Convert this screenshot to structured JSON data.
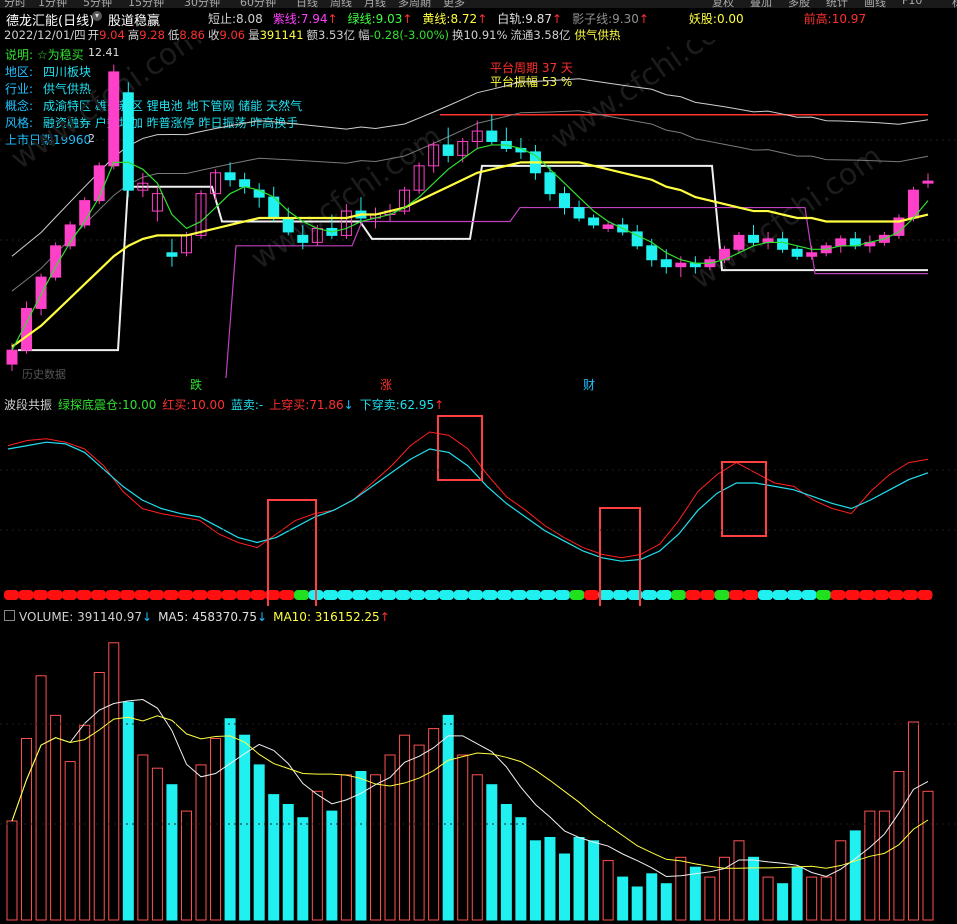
{
  "menu": {
    "periods": [
      "分时",
      "1分钟",
      "5分钟",
      "15分钟",
      "30分钟",
      "60分钟",
      "日线",
      "周线",
      "月线",
      "多周期",
      "更多"
    ],
    "right_buttons": [
      "复权",
      "叠加",
      "多股",
      "统计",
      "画线",
      "F10",
      "标记"
    ]
  },
  "header": {
    "stock_name": "德龙汇能(日线)",
    "indicator_name": "股道稳赢",
    "row1": [
      {
        "label": "短止:",
        "value": "8.08",
        "color": "#d0d0d0"
      },
      {
        "label": "紫线:",
        "value": "7.94",
        "arrow": "↑",
        "color": "#ff40ff"
      },
      {
        "label": "绿线:",
        "value": "9.03",
        "arrow": "↑",
        "color": "#40ff40"
      },
      {
        "label": "黄线:",
        "value": "8.72",
        "arrow": "↑",
        "color": "#ffff40"
      },
      {
        "label": "白轨:",
        "value": "9.87",
        "arrow": "↑",
        "color": "#e0e0e0"
      },
      {
        "label": "影子线:",
        "value": "9.30",
        "arrow": "↑",
        "color": "#909090"
      },
      {
        "label": "妖股:",
        "value": "0.00",
        "color": "#ffff40"
      },
      {
        "label": "前高:",
        "value": "10.97",
        "color": "#ff3030"
      }
    ],
    "row2": {
      "date": "2022/12/01/四",
      "open_label": "开",
      "open": "9.04",
      "high_label": "高",
      "high": "9.28",
      "low_label": "低",
      "low": "8.86",
      "close_label": "收",
      "close": "9.06",
      "vol_label": "量",
      "vol": "391141",
      "amount_label": "额",
      "amount": "3.53亿",
      "chg_label": "幅",
      "chg": "-0.28(-3.00%)",
      "turn_label": "换",
      "turn": "10.91%",
      "float_label": "流通",
      "float": "3.58亿",
      "tag": "供气供热"
    }
  },
  "info_panel": {
    "note": "说明: ☆为稳买",
    "region_label": "地区:",
    "region": "四川板块",
    "industry_label": "行业:",
    "industry": "供气供热",
    "concept_label": "概念:",
    "concept": "成渝特区 雄安新区 锂电池 地下管网 储能 天然气",
    "style_label": "风格:",
    "style": "融资融券 户数增加 昨普涨停 昨日振荡 昨高换手",
    "listing_label": "上市日期",
    "listing": "19960"
  },
  "platform": {
    "period_label": "平台周期",
    "period": "37 天",
    "amp_label": "平台振幅",
    "amp": "53 %"
  },
  "price_labels": {
    "max": "12.41",
    "min": "2"
  },
  "bottom_markers": [
    "跌",
    "涨",
    "财"
  ],
  "watermark": "www.cfchi.com",
  "wm_left": "历史数据",
  "colors": {
    "up": "#ff40c8",
    "down": "#20f0f0",
    "red": "#ff3030",
    "yellow": "#ffff40",
    "green": "#30e030",
    "white": "#f0f0f0",
    "purple": "#c040c0"
  },
  "osc": {
    "title": "波段共振",
    "items": [
      {
        "label": "绿探底震仓:",
        "value": "10.00",
        "color": "#30e030"
      },
      {
        "label": "红买:",
        "value": "10.00",
        "color": "#ff3030"
      },
      {
        "label": "蓝卖:",
        "value": "-",
        "color": "#20e0f0"
      },
      {
        "label": "上穿买:",
        "value": "71.86",
        "arrow": "↓",
        "color": "#ff3030"
      },
      {
        "label": "下穿卖:",
        "value": "62.95",
        "arrow": "↑",
        "color": "#20e0f0"
      }
    ]
  },
  "volume_panel": {
    "items": [
      {
        "label": "VOLUME:",
        "value": "391140.97",
        "arrow": "↓",
        "color": "#d0d0d0"
      },
      {
        "label": "MA5:",
        "value": "458370.75",
        "arrow": "↓",
        "color": "#e0e0e0"
      },
      {
        "label": "MA10:",
        "value": "316152.25",
        "arrow": "↑",
        "color": "#ffff40"
      }
    ]
  },
  "chart_data": {
    "type": "candlestick",
    "x_count": 64,
    "candles": [
      [
        3.8,
        4.4,
        3.6,
        4.2
      ],
      [
        4.2,
        5.6,
        4.1,
        5.4
      ],
      [
        5.4,
        6.4,
        5.2,
        6.3
      ],
      [
        6.3,
        7.3,
        6.2,
        7.2
      ],
      [
        7.2,
        7.9,
        7.1,
        7.8
      ],
      [
        7.8,
        8.6,
        7.7,
        8.5
      ],
      [
        8.5,
        9.6,
        8.4,
        9.5
      ],
      [
        9.5,
        12.41,
        9.4,
        12.2
      ],
      [
        11.6,
        11.9,
        8.6,
        8.8
      ],
      [
        8.8,
        9.3,
        8.6,
        9.0
      ],
      [
        8.2,
        8.9,
        7.9,
        8.7
      ],
      [
        7.0,
        7.4,
        6.6,
        6.9
      ],
      [
        7.0,
        7.6,
        6.9,
        7.5
      ],
      [
        7.5,
        8.8,
        7.4,
        8.7
      ],
      [
        8.7,
        9.4,
        8.5,
        9.3
      ],
      [
        9.3,
        9.6,
        8.9,
        9.1
      ],
      [
        9.1,
        9.3,
        8.7,
        8.9
      ],
      [
        8.8,
        9.0,
        8.3,
        8.6
      ],
      [
        8.6,
        8.9,
        7.9,
        8.0
      ],
      [
        8.0,
        8.3,
        7.5,
        7.6
      ],
      [
        7.5,
        7.8,
        7.1,
        7.3
      ],
      [
        7.3,
        7.8,
        7.2,
        7.7
      ],
      [
        7.7,
        8.1,
        7.4,
        7.5
      ],
      [
        7.5,
        8.4,
        7.4,
        8.2
      ],
      [
        8.2,
        8.6,
        7.9,
        8.0
      ],
      [
        8.0,
        8.3,
        7.7,
        8.1
      ],
      [
        8.1,
        8.4,
        7.9,
        8.2
      ],
      [
        8.2,
        8.9,
        8.1,
        8.8
      ],
      [
        8.8,
        9.6,
        8.7,
        9.5
      ],
      [
        9.5,
        10.2,
        9.3,
        10.1
      ],
      [
        10.1,
        10.6,
        9.6,
        9.8
      ],
      [
        9.8,
        10.3,
        9.6,
        10.2
      ],
      [
        10.2,
        10.8,
        10.0,
        10.5
      ],
      [
        10.5,
        10.97,
        10.1,
        10.2
      ],
      [
        10.2,
        10.6,
        9.9,
        10.0
      ],
      [
        10.0,
        10.3,
        9.7,
        9.9
      ],
      [
        9.9,
        10.1,
        9.1,
        9.3
      ],
      [
        9.3,
        9.5,
        8.5,
        8.7
      ],
      [
        8.7,
        8.9,
        8.1,
        8.3
      ],
      [
        8.3,
        8.5,
        7.9,
        8.0
      ],
      [
        8.0,
        8.1,
        7.7,
        7.8
      ],
      [
        7.7,
        7.9,
        7.6,
        7.8
      ],
      [
        7.8,
        8.0,
        7.5,
        7.6
      ],
      [
        7.6,
        7.8,
        7.1,
        7.2
      ],
      [
        7.2,
        7.4,
        6.6,
        6.8
      ],
      [
        6.8,
        7.1,
        6.4,
        6.6
      ],
      [
        6.6,
        6.9,
        6.3,
        6.7
      ],
      [
        6.7,
        6.9,
        6.4,
        6.6
      ],
      [
        6.6,
        6.9,
        6.5,
        6.8
      ],
      [
        6.8,
        7.2,
        6.7,
        7.1
      ],
      [
        7.1,
        7.6,
        7.0,
        7.5
      ],
      [
        7.5,
        7.8,
        7.2,
        7.3
      ],
      [
        7.3,
        7.6,
        7.1,
        7.4
      ],
      [
        7.4,
        7.6,
        7.0,
        7.1
      ],
      [
        7.1,
        7.2,
        6.8,
        6.9
      ],
      [
        6.9,
        7.2,
        6.8,
        7.0
      ],
      [
        7.0,
        7.3,
        6.9,
        7.2
      ],
      [
        7.2,
        7.5,
        7.0,
        7.4
      ],
      [
        7.4,
        7.6,
        7.1,
        7.2
      ],
      [
        7.2,
        7.5,
        7.0,
        7.3
      ],
      [
        7.3,
        7.6,
        7.2,
        7.5
      ],
      [
        7.5,
        8.1,
        7.4,
        8.0
      ],
      [
        8.0,
        8.9,
        7.9,
        8.8
      ],
      [
        9.04,
        9.28,
        8.86,
        9.06
      ]
    ],
    "ma_yellow": [
      4.3,
      4.6,
      4.9,
      5.3,
      5.7,
      6.1,
      6.5,
      6.9,
      7.2,
      7.4,
      7.5,
      7.5,
      7.5,
      7.6,
      7.7,
      7.8,
      7.9,
      8.0,
      8.0,
      8.0,
      8.0,
      8.0,
      8.0,
      8.0,
      8.1,
      8.1,
      8.2,
      8.3,
      8.5,
      8.7,
      8.9,
      9.1,
      9.3,
      9.4,
      9.5,
      9.6,
      9.6,
      9.6,
      9.6,
      9.6,
      9.5,
      9.4,
      9.3,
      9.2,
      9.1,
      8.9,
      8.8,
      8.6,
      8.5,
      8.4,
      8.3,
      8.2,
      8.2,
      8.1,
      8.0,
      8.0,
      7.9,
      7.9,
      7.9,
      7.9,
      7.9,
      7.9,
      8.0,
      8.1
    ],
    "ma_green": [
      4.2,
      5.0,
      5.8,
      6.6,
      7.3,
      7.9,
      8.6,
      9.6,
      9.6,
      9.4,
      9.0,
      8.1,
      7.7,
      7.9,
      8.3,
      8.7,
      8.9,
      8.8,
      8.6,
      8.2,
      7.9,
      7.7,
      7.6,
      7.7,
      7.9,
      8.0,
      8.1,
      8.3,
      8.6,
      9.0,
      9.4,
      9.7,
      10.0,
      10.1,
      10.1,
      10.0,
      9.8,
      9.4,
      9.0,
      8.6,
      8.2,
      7.9,
      7.7,
      7.5,
      7.3,
      7.0,
      6.8,
      6.7,
      6.7,
      6.8,
      7.0,
      7.2,
      7.3,
      7.3,
      7.2,
      7.1,
      7.1,
      7.2,
      7.2,
      7.3,
      7.4,
      7.6,
      8.0,
      8.5
    ],
    "osc_red": [
      82,
      85,
      86,
      84,
      80,
      70,
      55,
      45,
      42,
      40,
      38,
      30,
      25,
      22,
      30,
      38,
      42,
      44,
      50,
      60,
      70,
      82,
      90,
      88,
      80,
      65,
      52,
      44,
      35,
      28,
      22,
      18,
      16,
      18,
      24,
      38,
      55,
      65,
      72,
      66,
      60,
      58,
      50,
      45,
      42,
      55,
      65,
      72,
      74
    ],
    "osc_cyan": [
      80,
      82,
      84,
      83,
      78,
      68,
      58,
      50,
      45,
      42,
      40,
      34,
      28,
      25,
      28,
      34,
      40,
      44,
      50,
      58,
      66,
      74,
      80,
      78,
      70,
      58,
      48,
      40,
      32,
      26,
      20,
      16,
      14,
      15,
      20,
      30,
      44,
      54,
      60,
      60,
      58,
      56,
      52,
      48,
      45,
      50,
      56,
      62,
      66
    ],
    "volume": [
      3.0,
      5.5,
      7.4,
      6.2,
      4.8,
      5.9,
      7.5,
      8.4,
      6.6,
      5.0,
      4.6,
      4.1,
      3.3,
      4.7,
      5.5,
      6.1,
      5.6,
      4.7,
      3.8,
      3.5,
      3.1,
      3.9,
      3.3,
      4.4,
      4.5,
      4.4,
      5.0,
      5.6,
      5.3,
      5.8,
      6.2,
      5.0,
      4.4,
      4.1,
      3.5,
      3.1,
      2.4,
      2.5,
      2.0,
      2.5,
      2.4,
      1.8,
      1.3,
      1.0,
      1.4,
      1.1,
      1.9,
      1.6,
      1.3,
      1.9,
      2.4,
      1.9,
      1.3,
      1.1,
      1.6,
      1.3,
      1.3,
      2.4,
      2.7,
      3.3,
      3.3,
      4.5,
      6.0,
      3.9
    ]
  }
}
